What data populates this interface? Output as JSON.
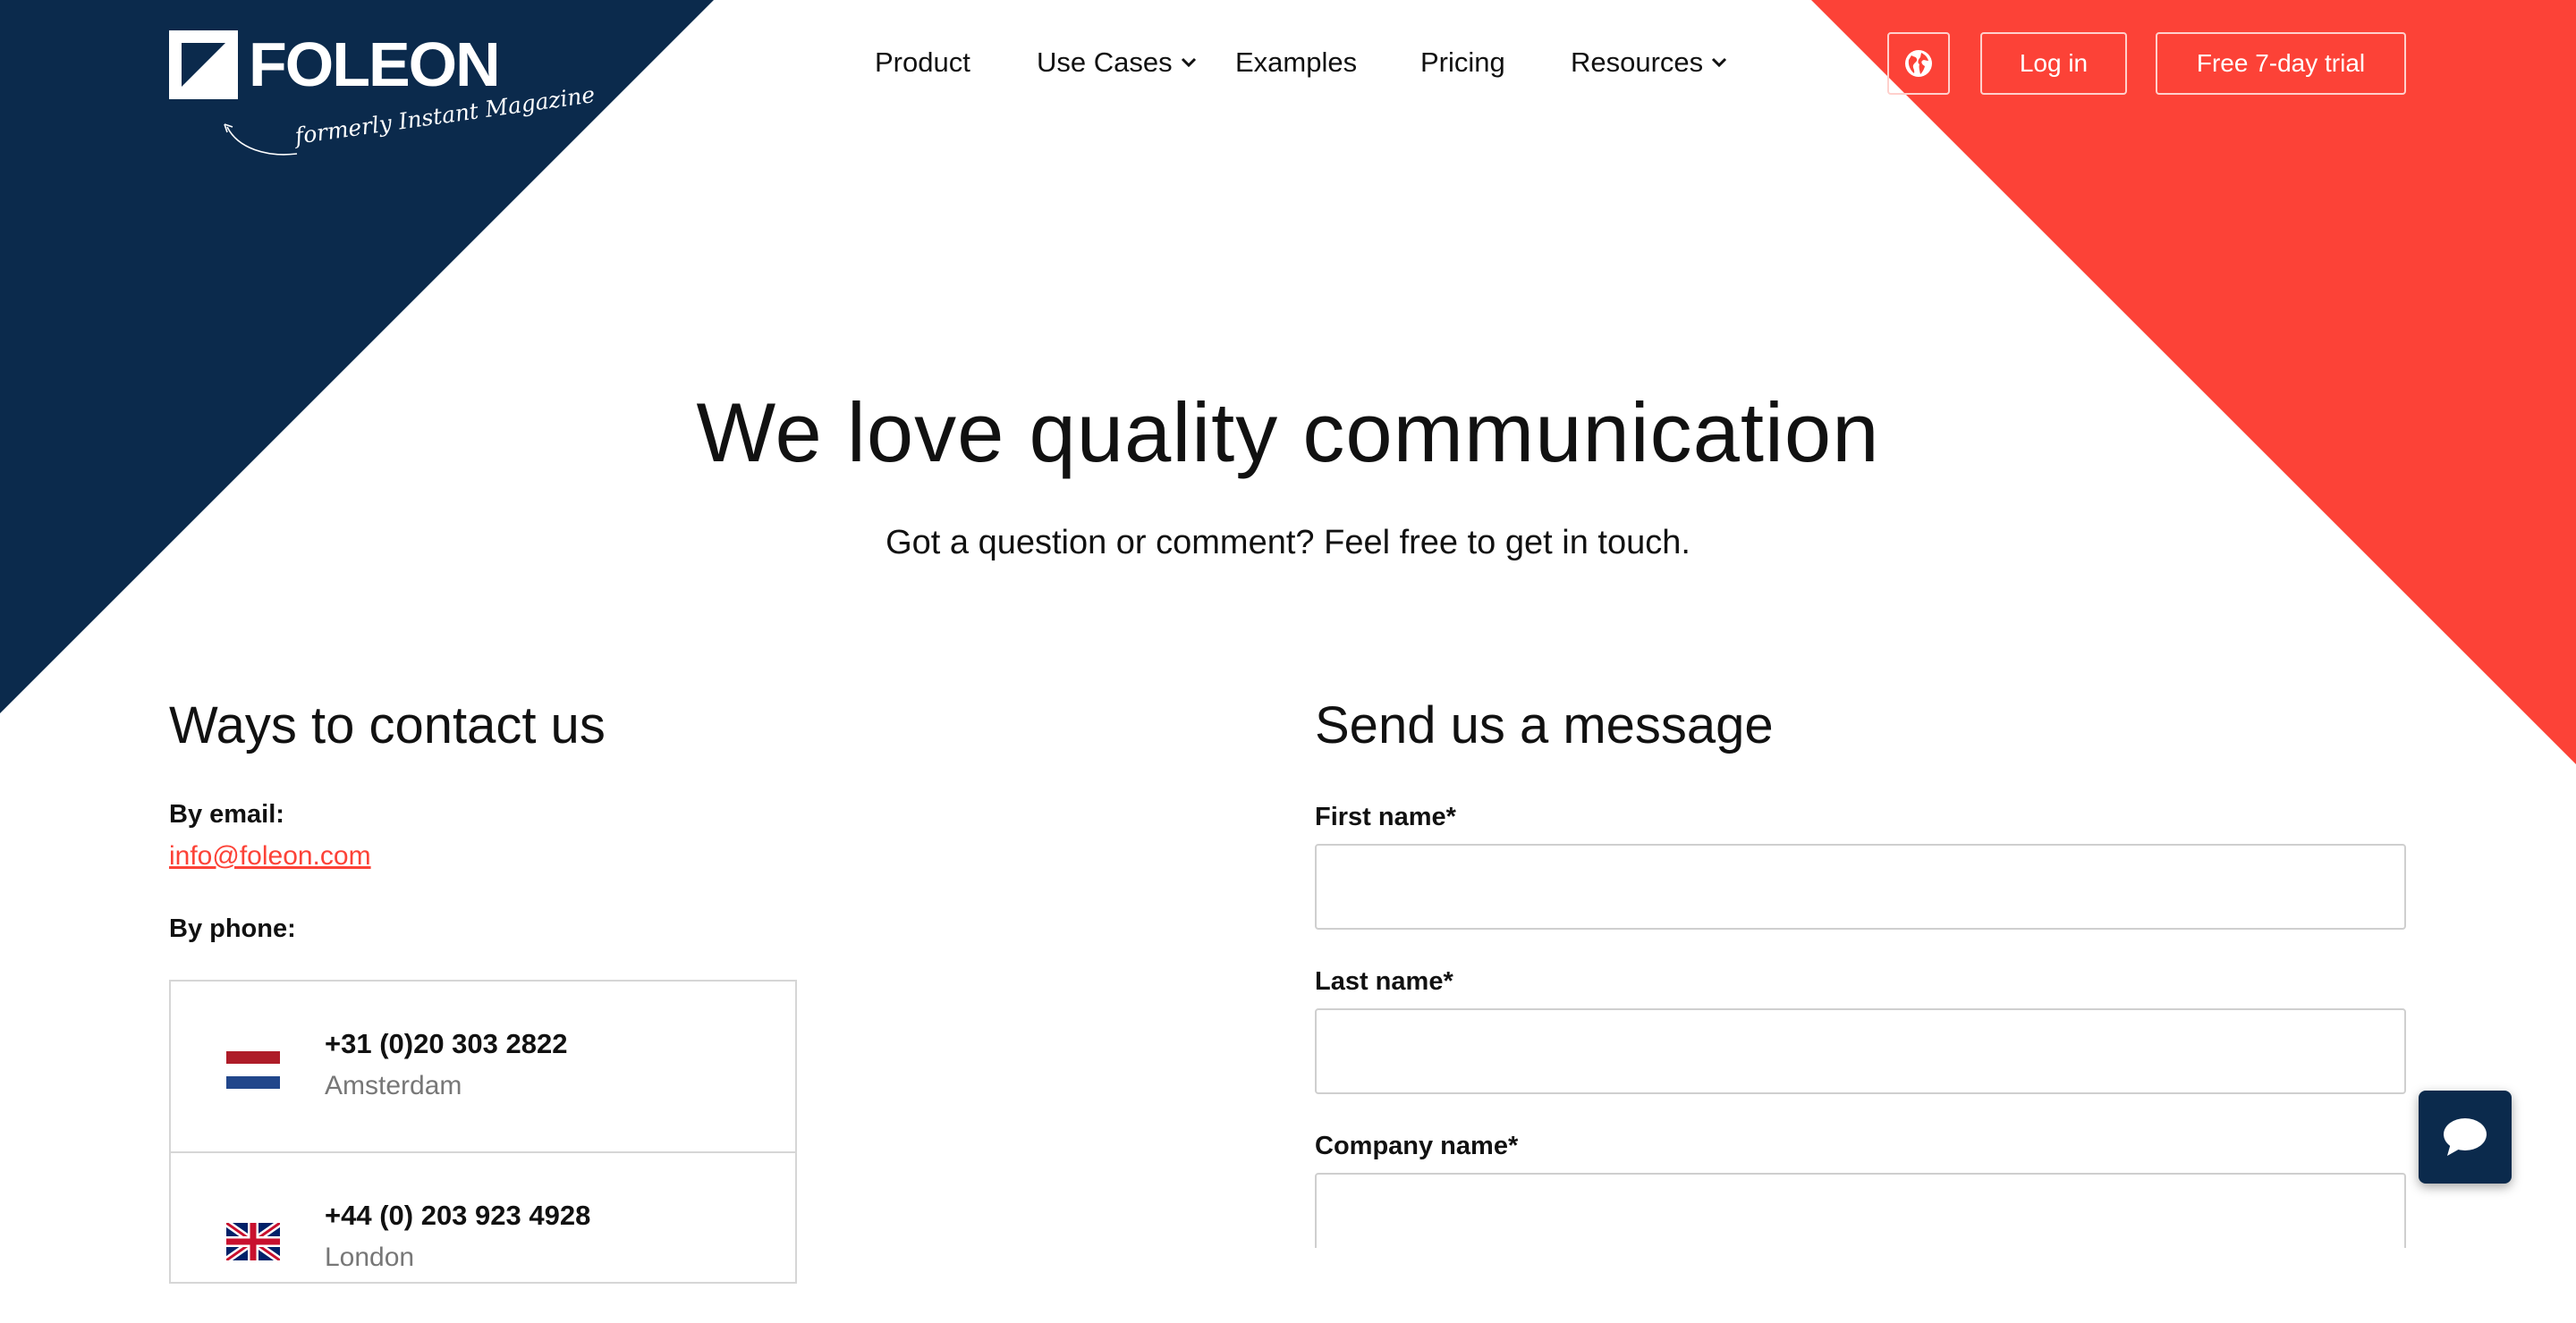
{
  "brand": {
    "name": "FOLEON",
    "tagline": "formerly Instant Magazine",
    "navy": "#0b2a4c",
    "red": "#fc4237"
  },
  "nav": {
    "items": [
      {
        "label": "Product",
        "has_dropdown": false
      },
      {
        "label": "Use Cases",
        "has_dropdown": true
      },
      {
        "label": "Examples",
        "has_dropdown": false
      },
      {
        "label": "Pricing",
        "has_dropdown": false
      },
      {
        "label": "Resources",
        "has_dropdown": true
      }
    ],
    "language_icon": "globe-icon",
    "login_label": "Log in",
    "trial_label": "Free 7-day trial"
  },
  "hero": {
    "title": "We love quality communication",
    "subtitle": "Got a question or comment? Feel free to get in touch."
  },
  "contact": {
    "heading": "Ways to contact us",
    "email_label": "By email:",
    "email": "info@foleon.com",
    "phone_label": "By phone:",
    "phones": [
      {
        "number": "+31 (0)20 303 2822",
        "city": "Amsterdam",
        "flag_icon": "netherlands-flag-icon"
      },
      {
        "number": "+44 (0) 203 923 4928",
        "city": "London",
        "flag_icon": "uk-flag-icon"
      }
    ]
  },
  "form": {
    "heading": "Send us a message",
    "fields": [
      {
        "label": "First name*",
        "value": ""
      },
      {
        "label": "Last name*",
        "value": ""
      },
      {
        "label": "Company name*",
        "value": ""
      }
    ]
  },
  "chat": {
    "icon": "chat-bubble-icon"
  }
}
